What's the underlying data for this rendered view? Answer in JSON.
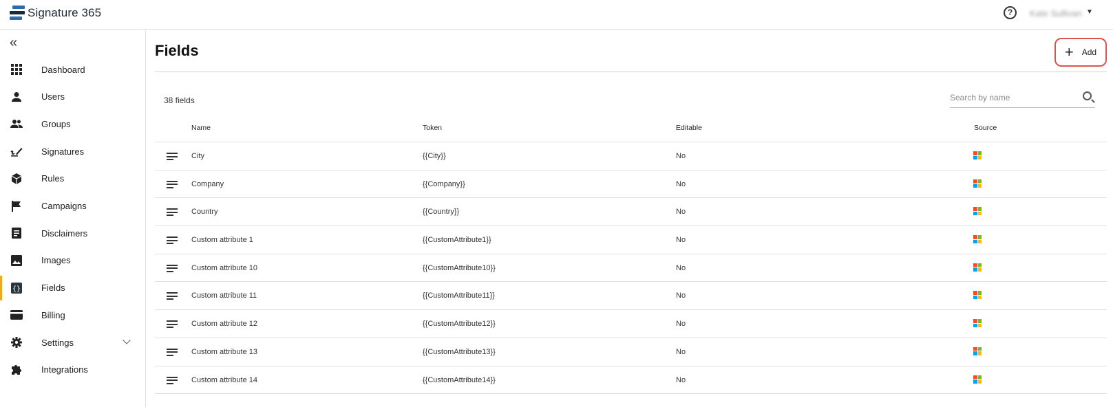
{
  "app": {
    "logo_text": "Signature 365",
    "user_name": "Kate Sullivan",
    "colors": {
      "accent": "#f5a623",
      "highlight": "#d9534f",
      "logo_dark": "#1b2a3a",
      "logo_blue": "#2b6cb0"
    }
  },
  "sidebar": {
    "items": [
      {
        "label": "Dashboard",
        "icon": "grid-icon"
      },
      {
        "label": "Users",
        "icon": "person-icon"
      },
      {
        "label": "Groups",
        "icon": "people-icon"
      },
      {
        "label": "Signatures",
        "icon": "signature-icon"
      },
      {
        "label": "Rules",
        "icon": "cube-icon"
      },
      {
        "label": "Campaigns",
        "icon": "flag-icon"
      },
      {
        "label": "Disclaimers",
        "icon": "document-icon"
      },
      {
        "label": "Images",
        "icon": "image-icon"
      },
      {
        "label": "Fields",
        "icon": "code-brackets-icon",
        "active": true
      },
      {
        "label": "Billing",
        "icon": "credit-card-icon"
      },
      {
        "label": "Settings",
        "icon": "gear-icon",
        "expandable": true
      },
      {
        "label": "Integrations",
        "icon": "puzzle-icon"
      }
    ]
  },
  "page": {
    "title": "Fields",
    "add_label": "Add",
    "count_text": "38 fields",
    "search": {
      "placeholder": "Search by name",
      "value": ""
    }
  },
  "table": {
    "columns": [
      "Name",
      "Token",
      "Editable",
      "Source"
    ],
    "rows": [
      {
        "name": "City",
        "token": "{{City}}",
        "editable": "No",
        "source": "microsoft-icon"
      },
      {
        "name": "Company",
        "token": "{{Company}}",
        "editable": "No",
        "source": "microsoft-icon"
      },
      {
        "name": "Country",
        "token": "{{Country}}",
        "editable": "No",
        "source": "microsoft-icon"
      },
      {
        "name": "Custom attribute 1",
        "token": "{{CustomAttribute1}}",
        "editable": "No",
        "source": "microsoft-icon"
      },
      {
        "name": "Custom attribute 10",
        "token": "{{CustomAttribute10}}",
        "editable": "No",
        "source": "microsoft-icon"
      },
      {
        "name": "Custom attribute 11",
        "token": "{{CustomAttribute11}}",
        "editable": "No",
        "source": "microsoft-icon"
      },
      {
        "name": "Custom attribute 12",
        "token": "{{CustomAttribute12}}",
        "editable": "No",
        "source": "microsoft-icon"
      },
      {
        "name": "Custom attribute 13",
        "token": "{{CustomAttribute13}}",
        "editable": "No",
        "source": "microsoft-icon"
      },
      {
        "name": "Custom attribute 14",
        "token": "{{CustomAttribute14}}",
        "editable": "No",
        "source": "microsoft-icon"
      }
    ]
  }
}
